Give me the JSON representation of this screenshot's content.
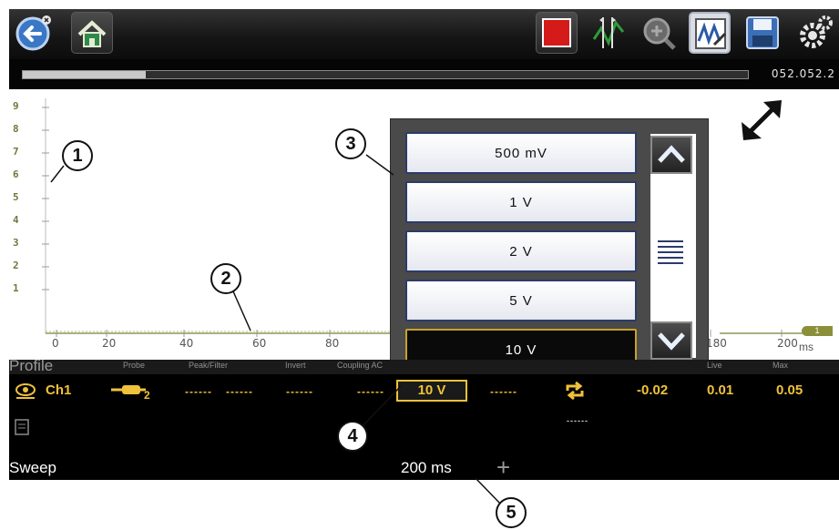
{
  "toolbar": {
    "buttons": [
      "back-icon",
      "home-icon",
      "stop-icon",
      "cursors-icon",
      "zoom-icon",
      "scope-icon",
      "save-icon",
      "settings-icon"
    ]
  },
  "progress": {
    "fraction": 0.17,
    "timestamp": "052.052.2"
  },
  "graph": {
    "y_ticks": [
      "9",
      "8",
      "7",
      "6",
      "5",
      "4",
      "3",
      "2",
      "1"
    ],
    "x_ticks": [
      "0",
      "20",
      "40",
      "60",
      "80",
      "180",
      "200"
    ],
    "x_unit": "ms",
    "trigger_marker": "1"
  },
  "scale_menu": {
    "options": [
      "500 mV",
      "1 V",
      "2 V",
      "5 V",
      "10 V"
    ],
    "selected": "10 V"
  },
  "profile": {
    "title": "Profile",
    "columns": [
      "Probe",
      "Peak/Filter",
      "Invert",
      "Coupling AC",
      "Live",
      "Max"
    ]
  },
  "channel": {
    "name": "Ch1",
    "placeholder": "------",
    "scale": "10 V",
    "min": "-0.02",
    "live": "0.01",
    "max": "0.05"
  },
  "sweep": {
    "label": "Sweep",
    "value": "200 ms",
    "plus": "+"
  },
  "callouts": [
    "1",
    "2",
    "3",
    "4",
    "5"
  ],
  "colors": {
    "toolbar": "#161616",
    "accent": "#f0c23a",
    "axis": "#6d7a3c"
  }
}
